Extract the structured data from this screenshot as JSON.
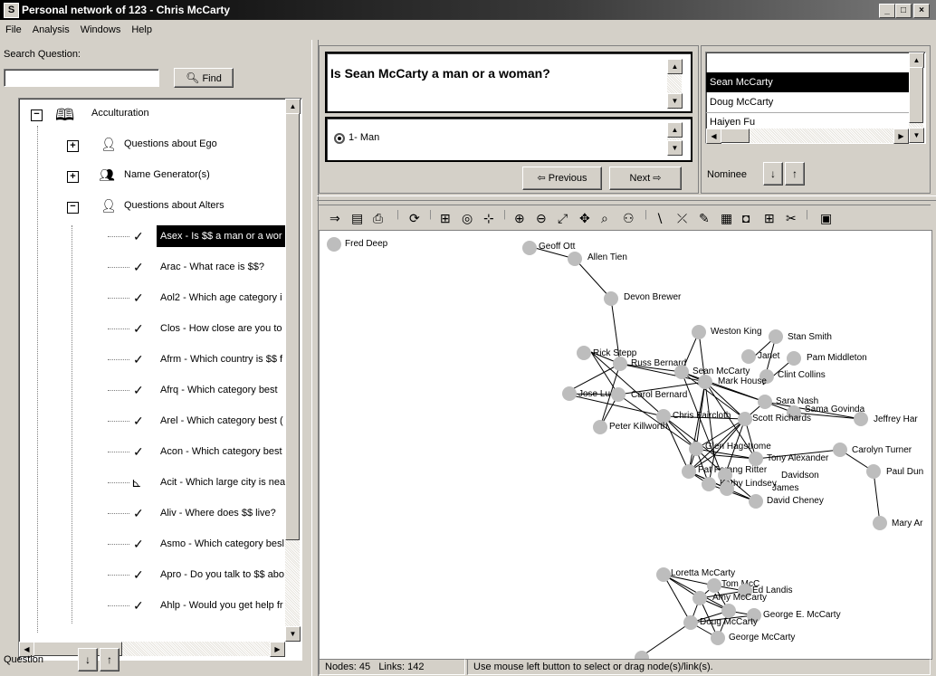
{
  "window": {
    "title": "Personal network of 123 - Chris McCarty",
    "app_icon": "app-icon",
    "minimize": "_",
    "maximize": "□",
    "close": "×"
  },
  "menu": [
    "File",
    "Analysis",
    "Windows",
    "Help"
  ],
  "search": {
    "label": "Search Question:",
    "value": "",
    "find_label": "Find"
  },
  "tree": {
    "root": "Acculturation",
    "groups": [
      "Questions about Ego",
      "Name Generator(s)",
      "Questions about Alters"
    ],
    "items": [
      "Asex - Is $$ a man or a wor",
      "Arac - What race is $$?",
      "Aol2 - Which age category i",
      "Clos - How close are you to",
      "Afrm - Which country is $$ f",
      "Afrq - Which category best",
      "Arel - Which category best (",
      "Acon - Which category best",
      "Acit - Which large city is nea",
      "Aliv - Where does $$ live?",
      "Asmo - Which category besl",
      "Apro - Do you talk to $$ abo",
      "Ahlp - Would you get help fr"
    ]
  },
  "question_nav_label": "Question",
  "question": {
    "text": "Is Sean McCarty a man or a woman?",
    "answer": "1- Man"
  },
  "nav": {
    "previous": "Previous",
    "next": "Next"
  },
  "nominees": {
    "items": [
      "Sean McCarty",
      "Doug McCarty",
      "Haiyen Fu"
    ],
    "selected": 0,
    "label": "Nominee"
  },
  "status": {
    "nodes_links": "Nodes: 45   Links: 142",
    "hint": "Use mouse left button to select or drag node(s)/link(s)."
  },
  "network": {
    "nodes": [
      {
        "id": "fd",
        "label": "Fred Deep"
      },
      {
        "id": "go",
        "label": "Geoff Ott"
      },
      {
        "id": "at",
        "label": "Allen Tien"
      },
      {
        "id": "db",
        "label": "Devon Brewer"
      },
      {
        "id": "wk",
        "label": "Weston King"
      },
      {
        "id": "ss",
        "label": "Stan Smith"
      },
      {
        "id": "ja",
        "label": "Janet"
      },
      {
        "id": "pm",
        "label": "Pam Middleton"
      },
      {
        "id": "rs",
        "label": "Rick Stepp"
      },
      {
        "id": "rb",
        "label": "Russ Bernard"
      },
      {
        "id": "sm",
        "label": "Sean McCarty"
      },
      {
        "id": "cc",
        "label": "Clint Collins"
      },
      {
        "id": "mh",
        "label": "Mark House"
      },
      {
        "id": "jl",
        "label": "Jose Lu"
      },
      {
        "id": "cb",
        "label": "Carol Bernard"
      },
      {
        "id": "sn",
        "label": "Sara Nash"
      },
      {
        "id": "sg",
        "label": "Sama Govinda"
      },
      {
        "id": "jh",
        "label": "Jeffrey Har"
      },
      {
        "id": "cf",
        "label": "Chris Faircloth"
      },
      {
        "id": "sr",
        "label": "Scott Richards"
      },
      {
        "id": "pk",
        "label": "Peter Killworth"
      },
      {
        "id": "gh",
        "label": "Glen Hagstrome"
      },
      {
        "id": "ct",
        "label": "Carolyn Turner"
      },
      {
        "id": "ta",
        "label": "Tony Alexander"
      },
      {
        "id": "pd",
        "label": "Paul Dun"
      },
      {
        "id": "pf",
        "label": "Pat Forang Ritter"
      },
      {
        "id": "dv",
        "label": "Davidson"
      },
      {
        "id": "kl",
        "label": "Kathy Lindsey"
      },
      {
        "id": "jm",
        "label": "James"
      },
      {
        "id": "dc",
        "label": "David Cheney"
      },
      {
        "id": "ma",
        "label": "Mary Ar"
      },
      {
        "id": "lm",
        "label": "Loretta McCarty"
      },
      {
        "id": "tm",
        "label": "Tom McC"
      },
      {
        "id": "el",
        "label": "Ed Landis"
      },
      {
        "id": "am",
        "label": "Amy McCarty"
      },
      {
        "id": "gem",
        "label": "George E. McCarty"
      },
      {
        "id": "dm",
        "label": "Doug McCarty"
      },
      {
        "id": "gm",
        "label": "George McCarty"
      }
    ]
  },
  "icons": {
    "find": "magnifier-icon",
    "collapse": "minus-icon",
    "expand": "plus-icon",
    "book": "book-icon",
    "person": "person-icon",
    "group": "group-icon",
    "check": "checkmark-icon",
    "down": "down-arrow-icon",
    "up": "up-arrow-icon",
    "prev": "left-arrow-icon",
    "next": "right-arrow-icon"
  },
  "toolbar_icons": [
    "export-icon",
    "save-icon",
    "print-icon",
    "refresh-icon",
    "layout-icon",
    "circle-layout-icon",
    "graph-icon",
    "zoom-in-icon",
    "zoom-out-icon",
    "fit-icon",
    "pan-icon",
    "find-icon",
    "group-icon",
    "line-icon",
    "link-icon",
    "edit-icon",
    "table-icon",
    "shape-icon",
    "add-icon",
    "cut-icon",
    "export-image-icon"
  ]
}
